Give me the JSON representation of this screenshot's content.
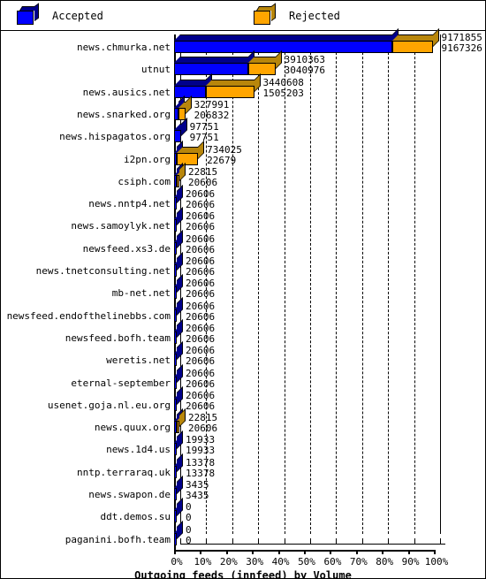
{
  "legend": {
    "items": [
      {
        "label": "Accepted",
        "color": "#0000ff",
        "icon": "cube-icon"
      },
      {
        "label": "Rejected",
        "color": "#ffa500",
        "icon": "cube-icon"
      }
    ]
  },
  "axis": {
    "title": "Outgoing feeds (innfeed) by Volume",
    "ticks": [
      "0%",
      "10%",
      "20%",
      "30%",
      "40%",
      "50%",
      "60%",
      "70%",
      "80%",
      "90%",
      "100%"
    ]
  },
  "colors": {
    "accepted": "#0000ff",
    "accepted_dark": "#00008b",
    "rejected": "#ffa500",
    "rejected_dark": "#b8860b",
    "outline": "#000000",
    "background": "#ffffff"
  },
  "chart_data": {
    "type": "bar",
    "orientation": "horizontal",
    "stacked": true,
    "title": "Outgoing feeds (innfeed) by Volume",
    "xlabel": "Outgoing feeds (innfeed) by Volume",
    "ylabel": "",
    "xlim": [
      0,
      100
    ],
    "xunit": "percent",
    "grid": true,
    "legend_position": "top",
    "xticks": [
      "0%",
      "10%",
      "20%",
      "30%",
      "40%",
      "50%",
      "60%",
      "70%",
      "80%",
      "90%",
      "100%"
    ],
    "categories": [
      "news.chmurka.net",
      "utnut",
      "news.ausics.net",
      "news.snarked.org",
      "news.hispagatos.org",
      "i2pn.org",
      "csiph.com",
      "news.nntp4.net",
      "news.samoylyk.net",
      "newsfeed.xs3.de",
      "news.tnetconsulting.net",
      "mb-net.net",
      "newsfeed.endofthelinebbs.com",
      "newsfeed.bofh.team",
      "weretis.net",
      "eternal-september",
      "usenet.goja.nl.eu.org",
      "news.quux.org",
      "news.1d4.us",
      "nntp.terraraq.uk",
      "news.swapon.de",
      "ddt.demos.su",
      "paganini.bofh.team"
    ],
    "series": [
      {
        "name": "Accepted",
        "color": "#0000ff",
        "values": [
          9171855,
          3910363,
          3440608,
          327991,
          97751,
          734025,
          22815,
          20606,
          20606,
          20606,
          20606,
          20606,
          20606,
          20606,
          20606,
          20606,
          20606,
          22815,
          19933,
          13378,
          3435,
          0,
          0
        ]
      },
      {
        "name": "Rejected",
        "color": "#ffa500",
        "values": [
          9167326,
          3040976,
          1505203,
          206832,
          97751,
          22679,
          20606,
          20606,
          20606,
          20606,
          20606,
          20606,
          20606,
          20606,
          20606,
          20606,
          20606,
          20606,
          19933,
          13378,
          3435,
          0,
          0
        ]
      }
    ]
  },
  "rows": [
    {
      "label": "news.chmurka.net",
      "accepted": "9171855",
      "rejected": "9167326",
      "acc_pct": 84.0,
      "rej_pct": 15.5
    },
    {
      "label": "utnut",
      "accepted": "3910363",
      "rejected": "3040976",
      "acc_pct": 28.5,
      "rej_pct": 10.5
    },
    {
      "label": "news.ausics.net",
      "accepted": "3440608",
      "rejected": "1505203",
      "acc_pct": 12.2,
      "rej_pct": 18.6
    },
    {
      "label": "news.snarked.org",
      "accepted": "327991",
      "rejected": "206832",
      "acc_pct": 1.6,
      "rej_pct": 2.7
    },
    {
      "label": "news.hispagatos.org",
      "accepted": "97751",
      "rejected": "97751",
      "acc_pct": 2.6,
      "rej_pct": 0.0
    },
    {
      "label": "i2pn.org",
      "accepted": "734025",
      "rejected": "22679",
      "acc_pct": 0.2,
      "rej_pct": 8.2
    },
    {
      "label": "csiph.com",
      "accepted": "22815",
      "rejected": "20606",
      "acc_pct": 0.2,
      "rej_pct": 0.6
    },
    {
      "label": "news.nntp4.net",
      "accepted": "20606",
      "rejected": "20606",
      "acc_pct": 0.9,
      "rej_pct": 0.0
    },
    {
      "label": "news.samoylyk.net",
      "accepted": "20606",
      "rejected": "20606",
      "acc_pct": 0.9,
      "rej_pct": 0.0
    },
    {
      "label": "newsfeed.xs3.de",
      "accepted": "20606",
      "rejected": "20606",
      "acc_pct": 0.9,
      "rej_pct": 0.0
    },
    {
      "label": "news.tnetconsulting.net",
      "accepted": "20606",
      "rejected": "20606",
      "acc_pct": 0.9,
      "rej_pct": 0.0
    },
    {
      "label": "mb-net.net",
      "accepted": "20606",
      "rejected": "20606",
      "acc_pct": 0.9,
      "rej_pct": 0.0
    },
    {
      "label": "newsfeed.endofthelinebbs.com",
      "accepted": "20606",
      "rejected": "20606",
      "acc_pct": 0.9,
      "rej_pct": 0.0
    },
    {
      "label": "newsfeed.bofh.team",
      "accepted": "20606",
      "rejected": "20606",
      "acc_pct": 0.9,
      "rej_pct": 0.0
    },
    {
      "label": "weretis.net",
      "accepted": "20606",
      "rejected": "20606",
      "acc_pct": 0.9,
      "rej_pct": 0.0
    },
    {
      "label": "eternal-september",
      "accepted": "20606",
      "rejected": "20606",
      "acc_pct": 0.9,
      "rej_pct": 0.0
    },
    {
      "label": "usenet.goja.nl.eu.org",
      "accepted": "20606",
      "rejected": "20606",
      "acc_pct": 0.9,
      "rej_pct": 0.0
    },
    {
      "label": "news.quux.org",
      "accepted": "22815",
      "rejected": "20606",
      "acc_pct": 0.0,
      "rej_pct": 0.9
    },
    {
      "label": "news.1d4.us",
      "accepted": "19933",
      "rejected": "19933",
      "acc_pct": 0.9,
      "rej_pct": 0.0
    },
    {
      "label": "nntp.terraraq.uk",
      "accepted": "13378",
      "rejected": "13378",
      "acc_pct": 0.9,
      "rej_pct": 0.0
    },
    {
      "label": "news.swapon.de",
      "accepted": "3435",
      "rejected": "3435",
      "acc_pct": 0.9,
      "rej_pct": 0.0
    },
    {
      "label": "ddt.demos.su",
      "accepted": "0",
      "rejected": "0",
      "acc_pct": 0.0,
      "rej_pct": 0.0
    },
    {
      "label": "paganini.bofh.team",
      "accepted": "0",
      "rejected": "0",
      "acc_pct": 0.0,
      "rej_pct": 0.0
    }
  ]
}
